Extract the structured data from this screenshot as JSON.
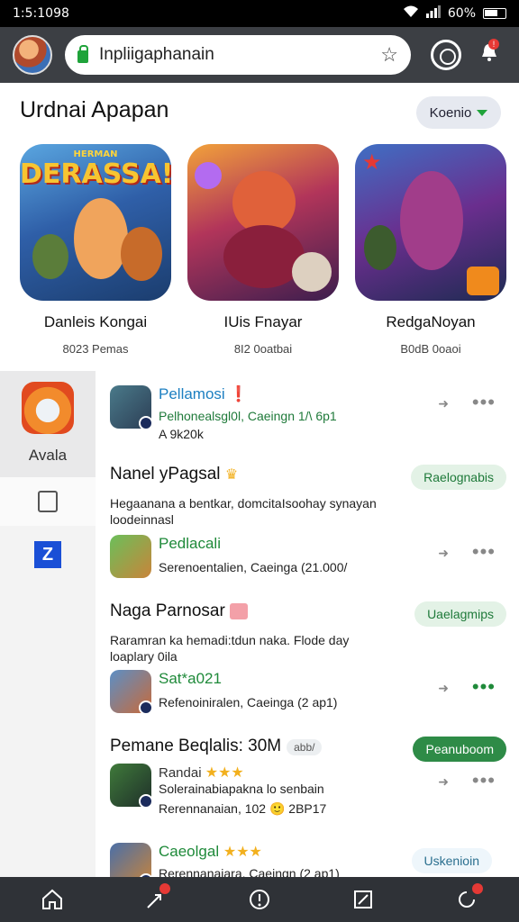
{
  "status": {
    "time": "1:5:1098",
    "battery": "60%"
  },
  "browser": {
    "url": "Inpliigaphanain",
    "star": "☆",
    "bell": "!"
  },
  "section": {
    "title": "Urdnai Apapan",
    "dropdown": "Koenio"
  },
  "featured": [
    {
      "name": "Danleis Kongai",
      "sub": "8023 Pemas",
      "banner": "DERASSA!",
      "banner_small": "HERMAN"
    },
    {
      "name": "IUis Fnayar",
      "sub": "8I2 0oatbai",
      "banner": "",
      "banner_small": ""
    },
    {
      "name": "RedgaNoyan",
      "sub": "B0dB 0oaoi",
      "banner": "",
      "banner_small": ""
    }
  ],
  "sidebar": {
    "active_label": "Avala",
    "z_label": "Z"
  },
  "list": {
    "app1": {
      "title": "Pellamosi ❗",
      "line1": "Pelhonealsgl0l, Caeingn 1/\\ 6p1",
      "line2": "A 9k20k"
    },
    "promo1": {
      "title": "Nanel yPagsal",
      "desc": "Hegaanana a bentkar, domcitaIsoohay synayan loodeinnasl",
      "pill": "Raelognabis"
    },
    "app2": {
      "title": "Pedlacali",
      "line1": "Serenoentalien, Caeinga (21.000/"
    },
    "promo2": {
      "title": "Naga Parnosar",
      "desc": "Raramran ka hemadi:tdun naka. Flode day loaplary 0ila",
      "pill": "Uaelagmips"
    },
    "app3": {
      "title": "Sat*a021",
      "line1": "Refenoiniralen, Caeinga (2 ap1)"
    },
    "promo3": {
      "title": "Pemane Beqlalis: 30M",
      "tag": "abb/",
      "pill": "Peanuboom"
    },
    "app4": {
      "title": "Randai",
      "stars": "★★★",
      "line1": "Solerainabiapakna lo senbain",
      "line2": "Rerennanaian, 102 🙂   2BP17"
    },
    "app5": {
      "title": "Caeolgal",
      "stars": "★★★",
      "line1": "Rerennanaiara, Caeingn (2 ap1)",
      "pill": "Uskenioin"
    }
  },
  "colors": {
    "accent": "#1fa33a",
    "link": "#1c7fc1",
    "toolbar": "#3c3f44"
  }
}
